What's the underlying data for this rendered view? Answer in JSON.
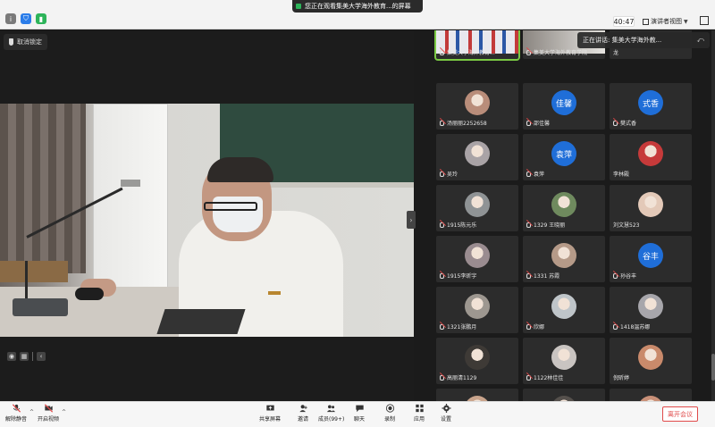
{
  "topbar": {
    "banner_text": "您正在观看集美大学海外教育...的屏幕",
    "timer": "40:47",
    "view_label": "演讲者视图",
    "status_colors": {
      "info": "#7a7a7a",
      "shield": "#2b7de9",
      "signal": "#2db45a"
    }
  },
  "screen": {
    "unpin_label": "取消锁定"
  },
  "speaking": {
    "text": "正在讲话: 集美大学海外教..."
  },
  "gallery": {
    "tiles": [
      {
        "name": "集美大学海外教育...",
        "kind": "thumb",
        "active": true
      },
      {
        "name": "集美大学海外教育学院",
        "kind": "thumb"
      },
      {
        "name": "龙",
        "kind": "thumb",
        "plain": true
      },
      {
        "name": "汤丽丽2252658",
        "kind": "photo",
        "color": "#b98d7a"
      },
      {
        "name": "邵佳馨",
        "kind": "text",
        "avatar": "佳馨"
      },
      {
        "name": "樊式香",
        "kind": "text",
        "avatar": "式香"
      },
      {
        "name": "吴玲",
        "kind": "photo",
        "color": "#a9a3a6"
      },
      {
        "name": "袁萍",
        "kind": "text",
        "avatar": "袁萍"
      },
      {
        "name": "李林殿",
        "kind": "photo",
        "color": "#c63a3a",
        "plain": true
      },
      {
        "name": "1915陈元乐",
        "kind": "photo",
        "color": "#8f9395"
      },
      {
        "name": "1329 王晓丽",
        "kind": "photo",
        "color": "#6f8a5e"
      },
      {
        "name": "刘文慧523",
        "kind": "photo",
        "color": "#e3c9b8",
        "plain": true
      },
      {
        "name": "1915李昕宇",
        "kind": "photo",
        "color": "#9a8c90"
      },
      {
        "name": "1331 苏霞",
        "kind": "photo",
        "color": "#b59a88"
      },
      {
        "name": "孙谷丰",
        "kind": "text",
        "avatar": "谷丰"
      },
      {
        "name": "1321张鹏月",
        "kind": "photo",
        "color": "#9d9790"
      },
      {
        "name": "欣娜",
        "kind": "photo",
        "color": "#bfc5c9"
      },
      {
        "name": "1418温苏娜",
        "kind": "photo",
        "color": "#a7a6ab"
      },
      {
        "name": "高丽清1129",
        "kind": "photo",
        "color": "#3e3a36"
      },
      {
        "name": "1122林佳佳",
        "kind": "photo",
        "color": "#c9c4c1"
      },
      {
        "name": "倪昕婷",
        "kind": "photo",
        "color": "#c98a6b",
        "plain": true
      },
      {
        "name": "",
        "kind": "photo",
        "color": "#c9a48c",
        "plain": true
      },
      {
        "name": "",
        "kind": "photo",
        "color": "#55504c",
        "plain": true
      },
      {
        "name": "",
        "kind": "photo",
        "color": "#c99078",
        "plain": true
      }
    ]
  },
  "toolbar": {
    "unmute": "解除静音",
    "start_video": "开启视频",
    "share": "共享屏幕",
    "invite": "邀请",
    "members": "成员(99+)",
    "chat": "聊天",
    "record": "录制",
    "apps": "应用",
    "settings": "设置",
    "leave": "离开会议",
    "accent_color": "#e04a4a"
  }
}
